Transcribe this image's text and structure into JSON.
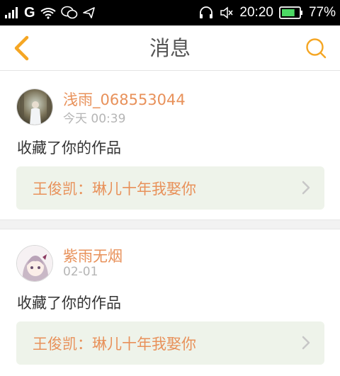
{
  "status_bar": {
    "carrier_letter": "G",
    "time": "20:20",
    "battery_percent": "77%",
    "battery_level": 0.77,
    "icons": [
      "signal-icon",
      "wifi-icon",
      "wechat-icon",
      "navigation-icon",
      "headset-icon",
      "mute-icon",
      "battery-icon"
    ]
  },
  "header": {
    "title": "消息",
    "back_icon": "chevron-left-icon",
    "search_icon": "search-icon"
  },
  "messages": [
    {
      "username": "浅雨_068553044",
      "time": "今天 00:39",
      "action": "收藏了你的作品",
      "work_title": "王俊凯：琳儿十年我娶你"
    },
    {
      "username": "紫雨无烟",
      "time": "02-01",
      "action": "收藏了你的作品",
      "work_title": "王俊凯：琳儿十年我娶你"
    }
  ],
  "colors": {
    "accent": "#e8915a",
    "back_arrow": "#f5a623",
    "link_bg": "#eef3ea"
  }
}
